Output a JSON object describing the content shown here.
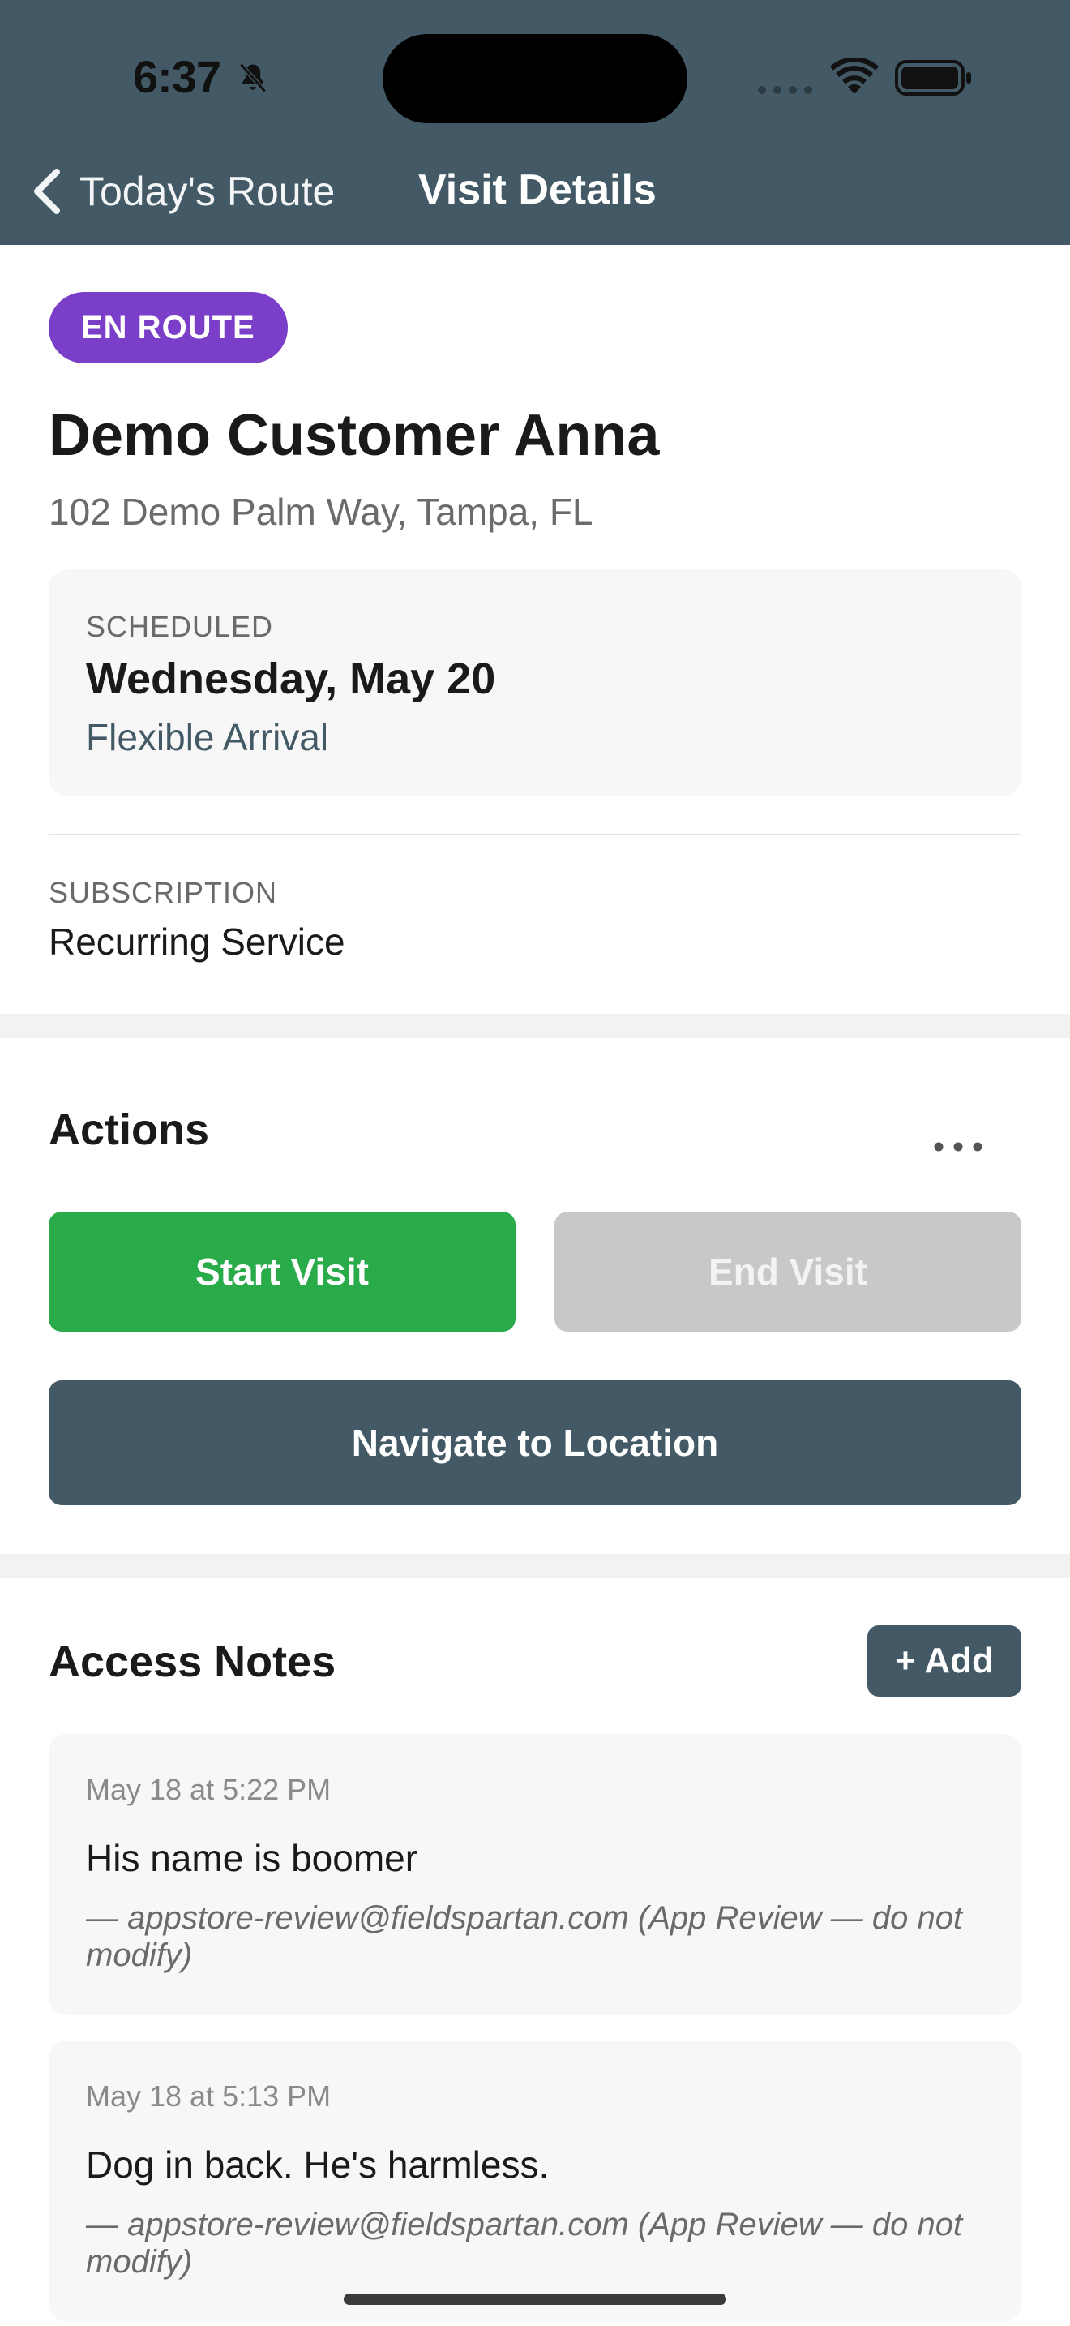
{
  "status_bar": {
    "time": "6:37"
  },
  "nav": {
    "back_label": "Today's Route",
    "title": "Visit Details"
  },
  "visit": {
    "status_badge": "EN ROUTE",
    "customer_name": "Demo Customer Anna",
    "address": "102 Demo Palm Way, Tampa, FL",
    "scheduled_label": "SCHEDULED",
    "scheduled_date": "Wednesday, May 20",
    "arrival": "Flexible Arrival",
    "subscription_label": "SUBSCRIPTION",
    "subscription_value": "Recurring Service"
  },
  "actions": {
    "title": "Actions",
    "start_label": "Start Visit",
    "end_label": "End Visit",
    "navigate_label": "Navigate to Location"
  },
  "notes": {
    "title": "Access Notes",
    "add_label": "+ Add",
    "items": [
      {
        "date": "May 18 at 5:22 PM",
        "text": "His name is boomer",
        "author": "— appstore-review@fieldspartan.com (App Review — do not modify)"
      },
      {
        "date": "May 18 at 5:13 PM",
        "text": "Dog in back. He's harmless.",
        "author": "— appstore-review@fieldspartan.com (App Review — do not modify)"
      }
    ]
  },
  "colors": {
    "header": "#435a66",
    "badge": "#7a3ec8",
    "start_button": "#2aab4a",
    "end_button_disabled": "#c8c8c8"
  }
}
